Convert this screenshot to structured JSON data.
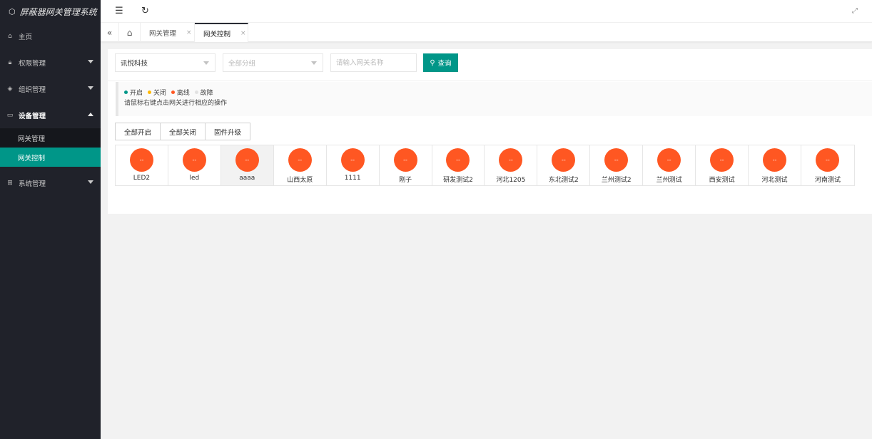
{
  "app": {
    "title": "屏蔽器网关管理系统",
    "logo_icon": "cube-icon"
  },
  "sidebar": {
    "items": [
      {
        "label": "主页",
        "icon": "home-icon"
      },
      {
        "label": "权限管理",
        "icon": "lock-icon"
      },
      {
        "label": "组织管理",
        "icon": "layers-icon"
      },
      {
        "label": "设备管理",
        "icon": "device-icon"
      },
      {
        "label": "系统管理",
        "icon": "grid-icon"
      }
    ],
    "submenu": [
      {
        "label": "网关管理"
      },
      {
        "label": "网关控制"
      }
    ]
  },
  "tabs": [
    {
      "label": "网关管理",
      "close": "×"
    },
    {
      "label": "网关控制",
      "close": "×"
    }
  ],
  "filters": {
    "company": "讯悦科技",
    "group_placeholder": "全部分组",
    "name_placeholder": "请输入网关名称",
    "search_label": "查询"
  },
  "notice": {
    "legend": [
      {
        "label": "开启",
        "color": "#009688"
      },
      {
        "label": "关闭",
        "color": "#ffb800"
      },
      {
        "label": "离线",
        "color": "#ff5722"
      },
      {
        "label": "故障",
        "color": "#e2e2e2"
      }
    ],
    "hint": "请鼠标右键点击网关进行相应的操作"
  },
  "actions": {
    "open_all": "全部开启",
    "close_all": "全部关闭",
    "firmware": "固件升级"
  },
  "status_colors": {
    "offline": "#ff5722",
    "accent": "#009688"
  },
  "gateways": [
    {
      "name": "LED2",
      "status": "--"
    },
    {
      "name": "led",
      "status": "--"
    },
    {
      "name": "aaaa",
      "status": "--"
    },
    {
      "name": "山西太原",
      "status": "--"
    },
    {
      "name": "1111",
      "status": "--"
    },
    {
      "name": "刚子",
      "status": "--"
    },
    {
      "name": "研发测试2",
      "status": "--"
    },
    {
      "name": "河北1205",
      "status": "--"
    },
    {
      "name": "东北测试2",
      "status": "--"
    },
    {
      "name": "兰州测试2",
      "status": "--"
    },
    {
      "name": "兰州测试",
      "status": "--"
    },
    {
      "name": "西安测试",
      "status": "--"
    },
    {
      "name": "河北测试",
      "status": "--"
    },
    {
      "name": "河南测试",
      "status": "--"
    }
  ]
}
